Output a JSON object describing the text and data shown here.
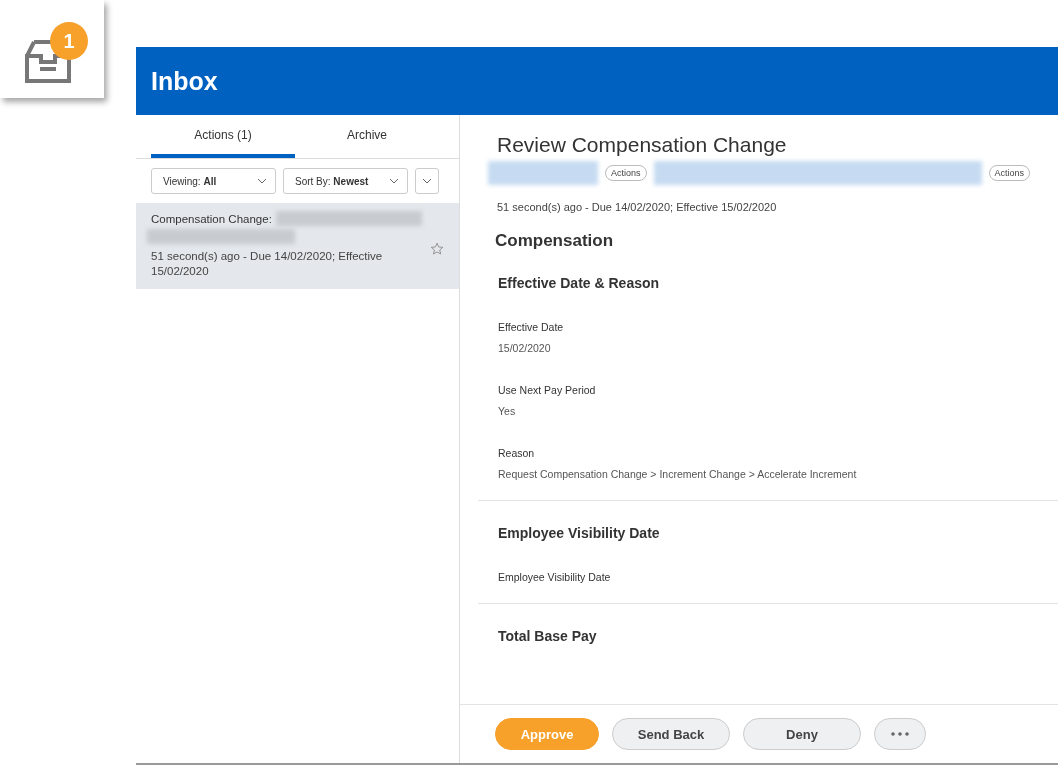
{
  "inbox_icon": {
    "badge": "1"
  },
  "header": {
    "title": "Inbox"
  },
  "tabs": [
    {
      "label": "Actions (1)",
      "selected": true
    },
    {
      "label": "Archive",
      "selected": false
    }
  ],
  "filters": [
    {
      "label": "Viewing:",
      "value": "All"
    },
    {
      "label": "Sort By:",
      "value": "Newest"
    }
  ],
  "items": [
    {
      "title": "Compensation Change:",
      "meta": "51 second(s) ago - Due 14/02/2020; Effective 15/02/2020",
      "selected": true,
      "starred": false
    }
  ],
  "detail": {
    "title": "Review Compensation Change",
    "subject_actions": [
      "Actions",
      "Actions"
    ],
    "meta": "51 second(s) ago - Due 14/02/2020; Effective 15/02/2020",
    "heading": "Compensation",
    "sections": [
      {
        "title": "Effective Date & Reason",
        "fields": [
          {
            "label": "Effective Date",
            "value": "15/02/2020"
          },
          {
            "label": "Use Next Pay Period",
            "value": "Yes"
          },
          {
            "label": "Reason",
            "value": "Request Compensation Change > Increment Change > Accelerate Increment"
          }
        ]
      },
      {
        "title": "Employee Visibility Date",
        "fields": [
          {
            "label": "Employee Visibility Date"
          }
        ]
      },
      {
        "title": "Total Base Pay"
      }
    ]
  },
  "buttons": [
    {
      "kind": "primary",
      "label": "Approve"
    },
    {
      "kind": "secondary",
      "label": "Send Back"
    },
    {
      "kind": "secondary",
      "label": "Deny"
    },
    {
      "kind": "more"
    }
  ]
}
